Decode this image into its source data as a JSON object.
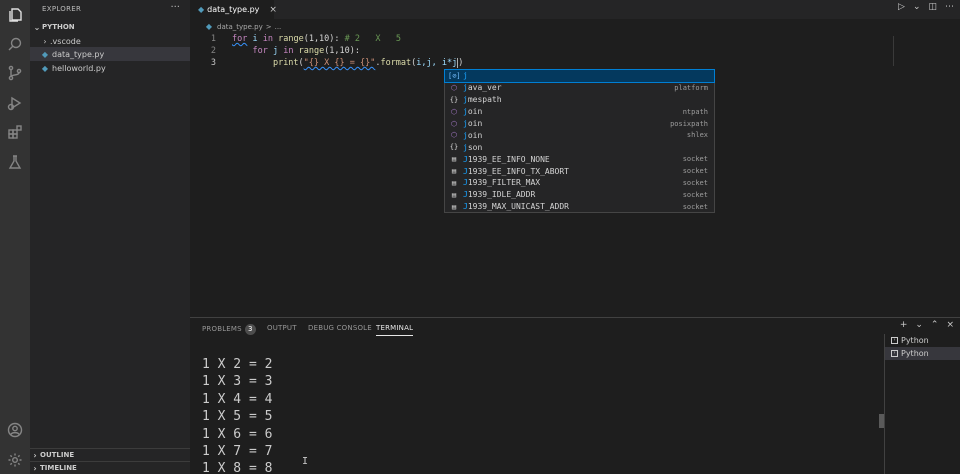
{
  "activity_bar": {
    "icons": [
      "explorer-icon",
      "search-icon",
      "source-control-icon",
      "run-debug-icon",
      "extensions-icon",
      "testing-icon",
      "account-icon",
      "settings-icon"
    ]
  },
  "sidebar": {
    "title": "EXPLORER",
    "more": "···",
    "section": "PYTHON",
    "items": [
      {
        "label": ".vscode",
        "type": "folder"
      },
      {
        "label": "data_type.py",
        "type": "python",
        "selected": true
      },
      {
        "label": "helloworld.py",
        "type": "python"
      }
    ],
    "outline": "OUTLINE",
    "timeline": "TIMELINE"
  },
  "tabs": [
    {
      "label": "data_type.py",
      "close": "×"
    }
  ],
  "breadcrumb": {
    "file": "data_type.py",
    "sep": ">",
    "rest": "..."
  },
  "editor": {
    "line_numbers": [
      "1",
      "2",
      "3"
    ],
    "line1": {
      "kw_for": "for",
      "i": "i",
      "kw_in": "in",
      "range": "range",
      "args": "(1,10):",
      "comment": "# 2   X   5"
    },
    "line2": {
      "kw_for": "for",
      "j": "j",
      "kw_in": "in",
      "range": "range",
      "args": "(1,10):"
    },
    "line3": {
      "print": "print",
      "open": "(",
      "string": "\"{} X {} = {}\"",
      "dot": ".",
      "format": "format",
      "args_open": "(",
      "args": "i,j, i*j",
      "close": ")"
    }
  },
  "suggest": {
    "items": [
      {
        "icon": "variable",
        "label": "j",
        "detail": ""
      },
      {
        "icon": "module",
        "label": "java_ver",
        "detail": "platform"
      },
      {
        "icon": "namespace",
        "label": "jmespath",
        "detail": ""
      },
      {
        "icon": "module",
        "label": "join",
        "detail": "ntpath"
      },
      {
        "icon": "module",
        "label": "join",
        "detail": "posixpath"
      },
      {
        "icon": "module",
        "label": "join",
        "detail": "shlex"
      },
      {
        "icon": "namespace",
        "label": "json",
        "detail": ""
      },
      {
        "icon": "constant",
        "label": "J1939_EE_INFO_NONE",
        "detail": "socket"
      },
      {
        "icon": "constant",
        "label": "J1939_EE_INFO_TX_ABORT",
        "detail": "socket"
      },
      {
        "icon": "constant",
        "label": "J1939_FILTER_MAX",
        "detail": "socket"
      },
      {
        "icon": "constant",
        "label": "J1939_IDLE_ADDR",
        "detail": "socket"
      },
      {
        "icon": "constant",
        "label": "J1939_MAX_UNICAST_ADDR",
        "detail": "socket"
      }
    ]
  },
  "panel": {
    "tabs": [
      "PROBLEMS",
      "OUTPUT",
      "DEBUG CONSOLE",
      "TERMINAL"
    ],
    "problems_count": "3",
    "active_tab": "TERMINAL",
    "terminal_output": [
      "1 X 2 = 2",
      "1 X 3 = 3",
      "1 X 4 = 4",
      "1 X 5 = 5",
      "1 X 6 = 6",
      "1 X 7 = 7",
      "1 X 8 = 8"
    ],
    "terminals": [
      {
        "label": "Python",
        "selected": false
      },
      {
        "label": "Python",
        "selected": true
      }
    ]
  }
}
